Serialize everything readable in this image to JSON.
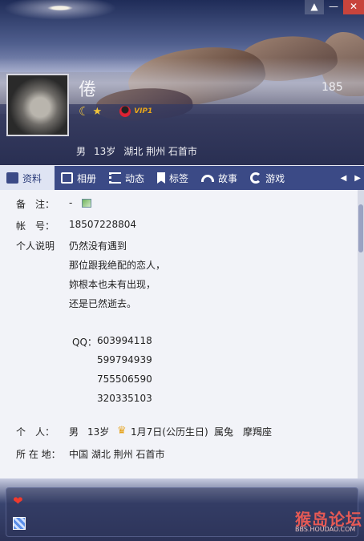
{
  "window": {
    "skin_icon": "skin-icon",
    "minimize": "—",
    "close": "✕"
  },
  "profile": {
    "nickname": "倦",
    "header_number": "185",
    "badges": [
      "moon-icon",
      "star-icon"
    ],
    "vip": "VIP1",
    "gender": "男",
    "age": "13岁",
    "location": "湖北 荆州 石首市"
  },
  "tabs": [
    {
      "label": "资料",
      "icon": "card-icon",
      "active": true
    },
    {
      "label": "相册",
      "icon": "photo-icon"
    },
    {
      "label": "动态",
      "icon": "list-icon"
    },
    {
      "label": "标签",
      "icon": "bookmark-icon"
    },
    {
      "label": "故事",
      "icon": "wifi-icon"
    },
    {
      "label": "游戏",
      "icon": "game-icon"
    }
  ],
  "tab_arrows": {
    "left": "◀",
    "right": "▶"
  },
  "details": {
    "remark_label": "备　注：",
    "remark_value": "-",
    "account_label": "帐　号：",
    "account_value": "18507228804",
    "desc_label": "个人说明",
    "desc_lines": [
      "仍然没有遇到",
      "那位跟我绝配的恋人，",
      "妳根本也未有出现，",
      "还是已然逝去。"
    ],
    "qq_label": "QQ：",
    "qq_numbers": [
      "603994118",
      "599794939",
      "755506590",
      "320335103"
    ],
    "personal_label": "个　人：",
    "personal_gender": "男",
    "personal_age": "13岁",
    "birthday": "1月7日(公历生日)",
    "zodiac": "属兔",
    "constellation": "摩羯座",
    "location_label": "所 在 地：",
    "location_value": "中国 湖北 荆州 石首市"
  },
  "watermark": {
    "text": "猴岛论坛",
    "url": "BBS.HOUDAO.COM"
  },
  "colors": {
    "tab_bar": "#3b4a86",
    "active_tab": "#dfe4f3",
    "vip": "#e8a61a"
  }
}
